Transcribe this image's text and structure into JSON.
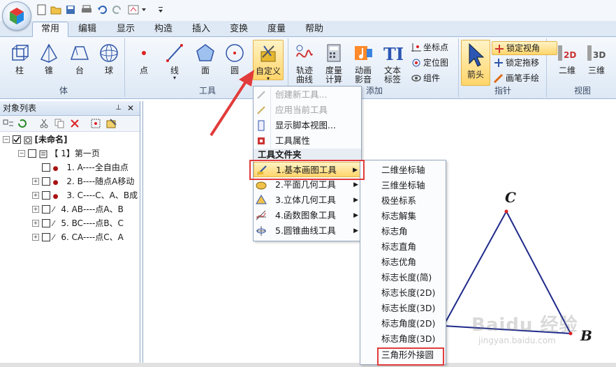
{
  "ribbon_tabs": [
    "常用",
    "编辑",
    "显示",
    "构造",
    "插入",
    "变换",
    "度量",
    "帮助"
  ],
  "groups": {
    "body": {
      "title": "体",
      "buttons": [
        "柱",
        "锥",
        "台",
        "球"
      ]
    },
    "tools": {
      "title": "工具",
      "buttons": [
        "点",
        "线",
        "面",
        "圆"
      ],
      "custom": "自定义"
    },
    "add": {
      "title": "添加",
      "buttons": [
        "轨迹\n曲线",
        "度量\n计算",
        "动画\n影音",
        "文本\n标签"
      ],
      "trace_label": [
        "轨迹",
        "曲线"
      ],
      "measure_label": [
        "度量",
        "计算"
      ],
      "anim_label": [
        "动画",
        "影音"
      ],
      "text_label": [
        "文本",
        "标签"
      ],
      "small": [
        "坐标点",
        "定位图",
        "组件"
      ]
    },
    "pointer": {
      "title": "指针",
      "arrow": "箭头",
      "small": [
        "锁定视角",
        "锁定拖移",
        "画笔手绘"
      ]
    },
    "view": {
      "title": "视图",
      "buttons": [
        "二维",
        "三维"
      ]
    }
  },
  "object_list": {
    "title": "对象列表",
    "root": "[未命名]",
    "page": "【 1】第一页",
    "items": [
      "1. A----全自由点",
      "2. B----随点A移动",
      "3. C----C、A、B成",
      "4. AB----点A、B",
      "5. BC----点B、C",
      "6. CA----点C、A"
    ]
  },
  "custom_menu": {
    "items": [
      "创建新工具...",
      "应用当前工具",
      "显示脚本视图...",
      "工具属性"
    ],
    "section": "工具文件夹",
    "folders": [
      "1.基本画图工具",
      "2.平面几何工具",
      "3.立体几何工具",
      "4.函数图象工具",
      "5.圆锥曲线工具"
    ]
  },
  "submenu": {
    "items": [
      "二维坐标轴",
      "三维坐标轴",
      "极坐标系",
      "标志解集",
      "标志角",
      "标志直角",
      "标志优角",
      "标志长度(简)",
      "标志长度(2D)",
      "标志长度(3D)",
      "标志角度(2D)",
      "标志角度(3D)",
      "三角形外接圆"
    ]
  },
  "canvas": {
    "labels": [
      "C",
      "B"
    ],
    "watermark_main": "Baidu 经验",
    "watermark_sub": "jingyan.baidu.com"
  },
  "colors": {
    "highlight": "#ffd56a",
    "annotation_red": "#e23b3b",
    "triangle": "#1f2a8a"
  }
}
